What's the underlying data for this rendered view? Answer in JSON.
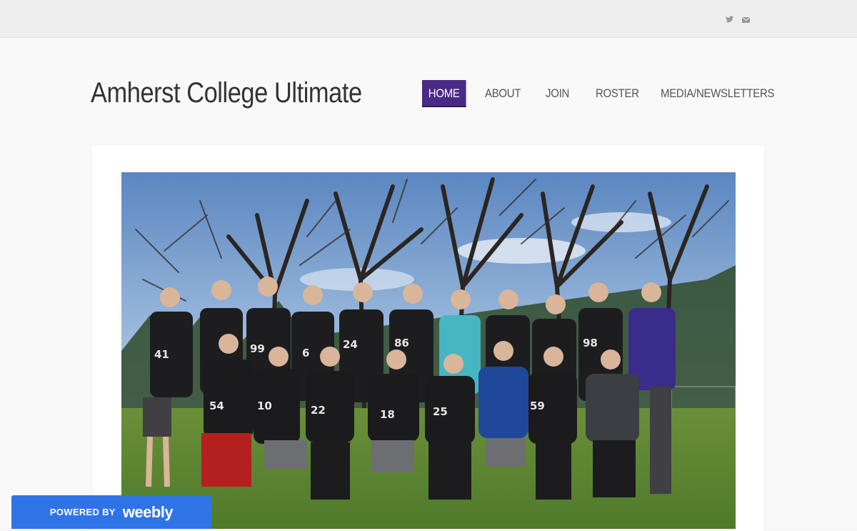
{
  "topbar": {
    "social_icons": [
      "twitter-icon",
      "mail-icon"
    ]
  },
  "site": {
    "title": "Amherst College Ultimate"
  },
  "nav": {
    "items": [
      {
        "label": "HOME",
        "active": true
      },
      {
        "label": "ABOUT",
        "active": false
      },
      {
        "label": "JOIN",
        "active": false
      },
      {
        "label": "ROSTER",
        "active": false
      },
      {
        "label": "MEDIA/NEWSLETTERS",
        "active": false
      }
    ]
  },
  "hero": {
    "jersey_numbers": [
      "41",
      "99",
      "6",
      "24",
      "86",
      "98",
      "54",
      "10",
      "22",
      "18",
      "25",
      "59"
    ]
  },
  "footer_badge": {
    "powered_by": "POWERED BY",
    "brand": "weebly"
  },
  "colors": {
    "nav_active_bg": "#4b2a86",
    "badge_bg": "#2f74e6"
  }
}
